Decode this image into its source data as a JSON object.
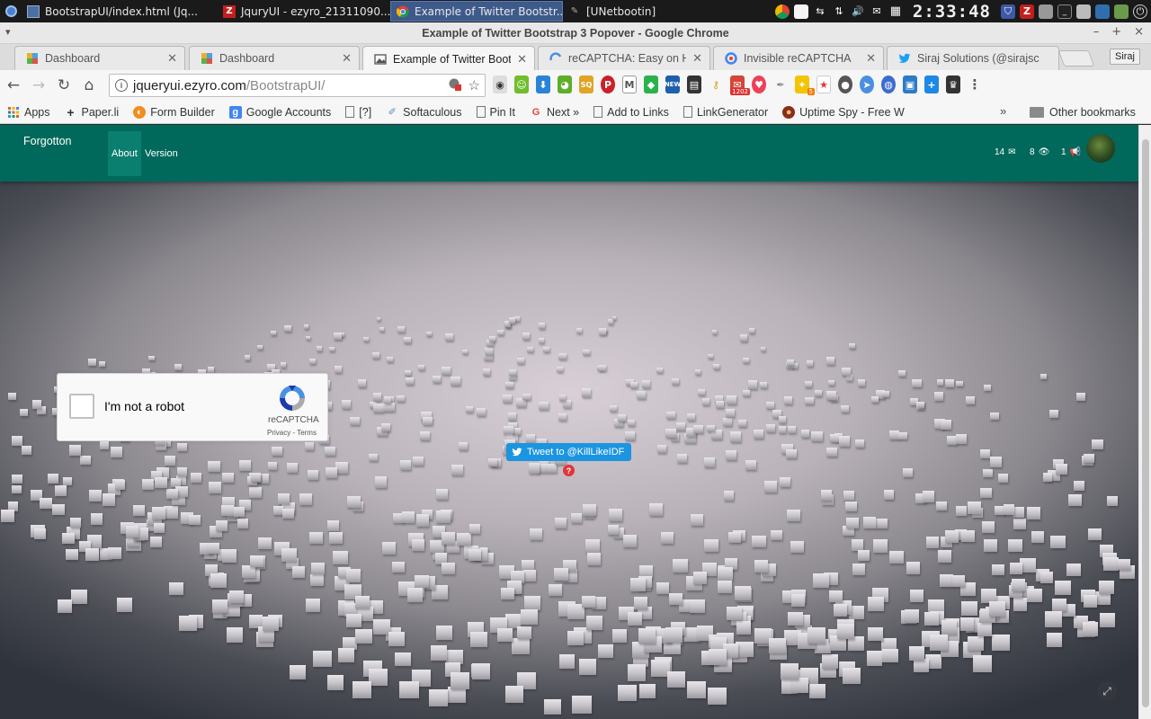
{
  "taskbar": {
    "tasks": [
      {
        "label": "BootstrapUI/index.html (Jq...",
        "icon": "window-icon"
      },
      {
        "label": "JquryUI - ezyro_21311090...",
        "icon": "filezilla-icon"
      },
      {
        "label": "Example of Twitter Bootstr...",
        "icon": "chrome-icon",
        "active": true
      },
      {
        "label": "[UNetbootin]",
        "icon": "unetbootin-icon"
      }
    ],
    "clock": "2:33:48"
  },
  "window": {
    "title": "Example of Twitter Bootstrap 3 Popover - Google Chrome",
    "controls": [
      "–",
      "+",
      "×"
    ]
  },
  "tabs": [
    {
      "label": "Dashboard",
      "icon": "dashboard-favicon"
    },
    {
      "label": "Dashboard",
      "icon": "dashboard-favicon"
    },
    {
      "label": "Example of Twitter Boot",
      "icon": "image-favicon",
      "active": true
    },
    {
      "label": "reCAPTCHA: Easy on Hu",
      "icon": "recaptcha-favicon"
    },
    {
      "label": "Invisible reCAPTCHA",
      "icon": "google-favicon"
    },
    {
      "label": "Siraj Solutions (@sirajsc",
      "icon": "twitter-favicon"
    }
  ],
  "profile_label": "Siraj",
  "omnibox": {
    "host": "jqueryui.ezyro.com",
    "path": "/BootstrapUI/"
  },
  "extensions": {
    "gmail_badge": "1202",
    "bulb_badge": "5"
  },
  "bookmarks": {
    "items": [
      {
        "label": "Apps",
        "icon": "apps-grid-icon"
      },
      {
        "label": "Paper.li",
        "icon": "plus-icon"
      },
      {
        "label": "Form Builder",
        "icon": "form-builder-icon"
      },
      {
        "label": "Google Accounts",
        "icon": "google-icon"
      },
      {
        "label": "[?]",
        "icon": "page-icon"
      },
      {
        "label": "Softaculous",
        "icon": "softaculous-icon"
      },
      {
        "label": "Pin It",
        "icon": "page-icon"
      },
      {
        "label": "Next »",
        "icon": "google-icon"
      },
      {
        "label": "Add to Links",
        "icon": "page-icon"
      },
      {
        "label": "LinkGenerator",
        "icon": "page-icon"
      },
      {
        "label": "Uptime Spy - Free W",
        "icon": "uptime-icon"
      }
    ],
    "chevron": "»",
    "other": "Other bookmarks"
  },
  "app": {
    "brand": "Forgotton",
    "nav": [
      "About",
      "Version"
    ],
    "stats": {
      "messages": "14",
      "views": "8",
      "alerts": "1"
    }
  },
  "recaptcha": {
    "label": "I'm not a robot",
    "brand": "reCAPTCHA",
    "links": "Privacy - Terms"
  },
  "tweet": {
    "label": "Tweet to @KillLikeIDF"
  },
  "popover_marker": "?",
  "colors": {
    "navbar": "#00695c",
    "twitter": "#1b95e0",
    "marker": "#e2343c"
  }
}
